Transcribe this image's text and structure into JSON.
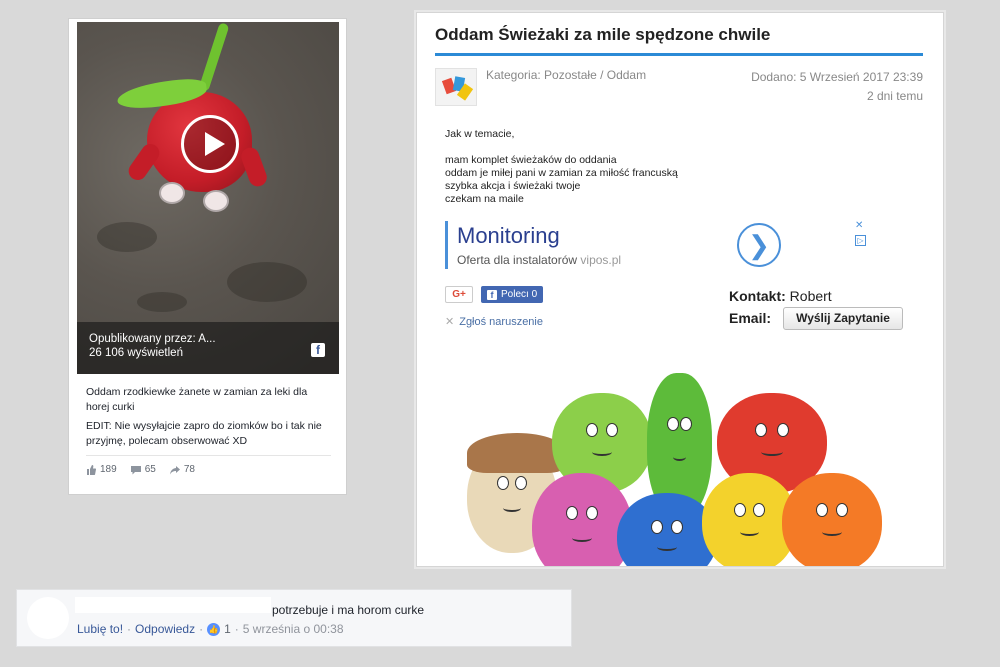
{
  "fb_post": {
    "overlay_published": "Opublikowany przez: A...",
    "overlay_views": "26 106 wyświetleń",
    "fb_icon": "f",
    "text_line1": "Oddam rzodkiewke żanete w zamian za leki dla horej curki",
    "text_line2": "EDIT: Nie wysyłajcie zapro do ziomków bo i tak nie przyjmę, polecam obserwować XD",
    "likes": "189",
    "comments": "65",
    "shares": "78"
  },
  "listing": {
    "title": "Oddam Świeżaki za mile spędzone chwile",
    "category": "Kategoria: Pozostałe / Oddam",
    "added": "Dodano: 5 Wrzesień 2017 23:39",
    "ago": "2 dni temu",
    "body": {
      "l1": "Jak w temacie,",
      "l2": "mam komplet świeżaków do oddania",
      "l3": "oddam je miłej pani w zamian za miłość francuską",
      "l4": "szybka akcja i świeżaki twoje",
      "l5": "czekam na maile"
    },
    "ad": {
      "title": "Monitoring",
      "subtitle": "Oferta dla instalatorów",
      "domain": "vipos.pl",
      "arrow": "❯",
      "close": "✕",
      "info": "▷"
    },
    "gplus_label": "G+",
    "fb_like_icon": "f",
    "fb_like_label": "Polecı 0",
    "report_icon": "✕",
    "report_label": "Zgłoś naruszenie",
    "contact_label": "Kontakt:",
    "contact_value": "Robert",
    "email_label": "Email:",
    "send_button": "Wyślij Zapytanie"
  },
  "comment": {
    "text": "potrzebuje i ma horom curke",
    "like": "Lubię to!",
    "reply": "Odpowiedz",
    "reaction_icon": "👍",
    "reaction_count": "1",
    "date": "5 września o 00:38"
  },
  "colors": {
    "accent_blue": "#2b8ad6",
    "fb_blue": "#4267b2",
    "link_blue": "#385898"
  }
}
